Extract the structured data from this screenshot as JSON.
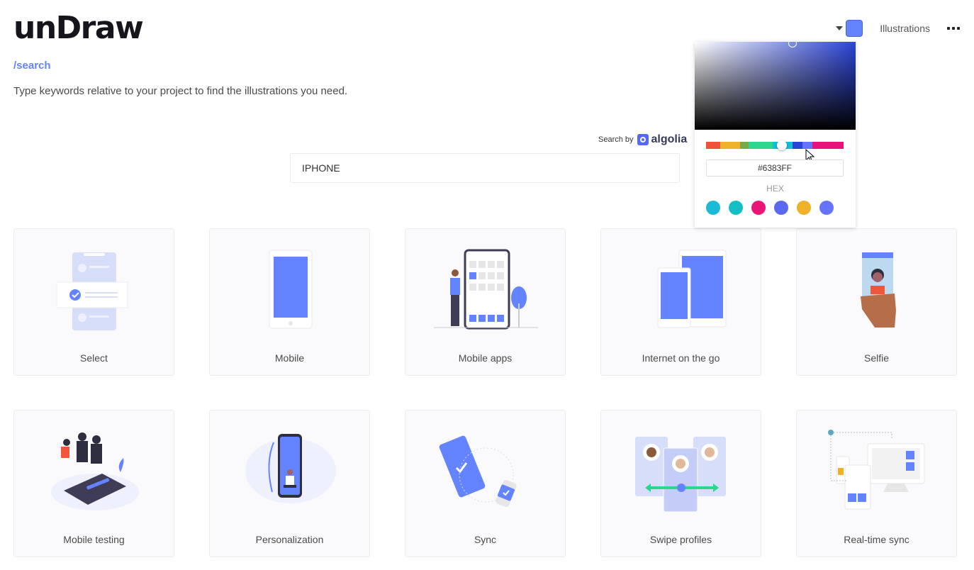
{
  "app": {
    "logo": "unDraw",
    "route": "/search",
    "intro": "Type keywords relative to your project to find the illustrations you need."
  },
  "topnav": {
    "accent_color": "#6383FF",
    "illustrations_label": "Illustrations",
    "more_icon": "ellipsis-icon"
  },
  "color_picker": {
    "hex_value": "#6383FF",
    "hex_label": "HEX",
    "hue_segments": [
      "#f0513a",
      "#eeb12a",
      "#7aa84a",
      "#2cd68c",
      "#12bfd6",
      "#2b44d6",
      "#6673ff",
      "#e8137a"
    ],
    "presets": [
      "#1bbad6",
      "#13bfc4",
      "#e91677",
      "#5b68f0",
      "#efb02a",
      "#6673ff"
    ]
  },
  "search": {
    "powered_by": "Search by",
    "provider": "algolia",
    "query": "IPHONE"
  },
  "results": [
    {
      "title": "Select",
      "art": "select"
    },
    {
      "title": "Mobile",
      "art": "mobile"
    },
    {
      "title": "Mobile apps",
      "art": "mobile-apps"
    },
    {
      "title": "Internet on the go",
      "art": "internet-on-the-go"
    },
    {
      "title": "Selfie",
      "art": "selfie"
    },
    {
      "title": "Mobile testing",
      "art": "mobile-testing"
    },
    {
      "title": "Personalization",
      "art": "personalization"
    },
    {
      "title": "Sync",
      "art": "sync"
    },
    {
      "title": "Swipe profiles",
      "art": "swipe-profiles"
    },
    {
      "title": "Real-time sync",
      "art": "real-time-sync"
    }
  ]
}
